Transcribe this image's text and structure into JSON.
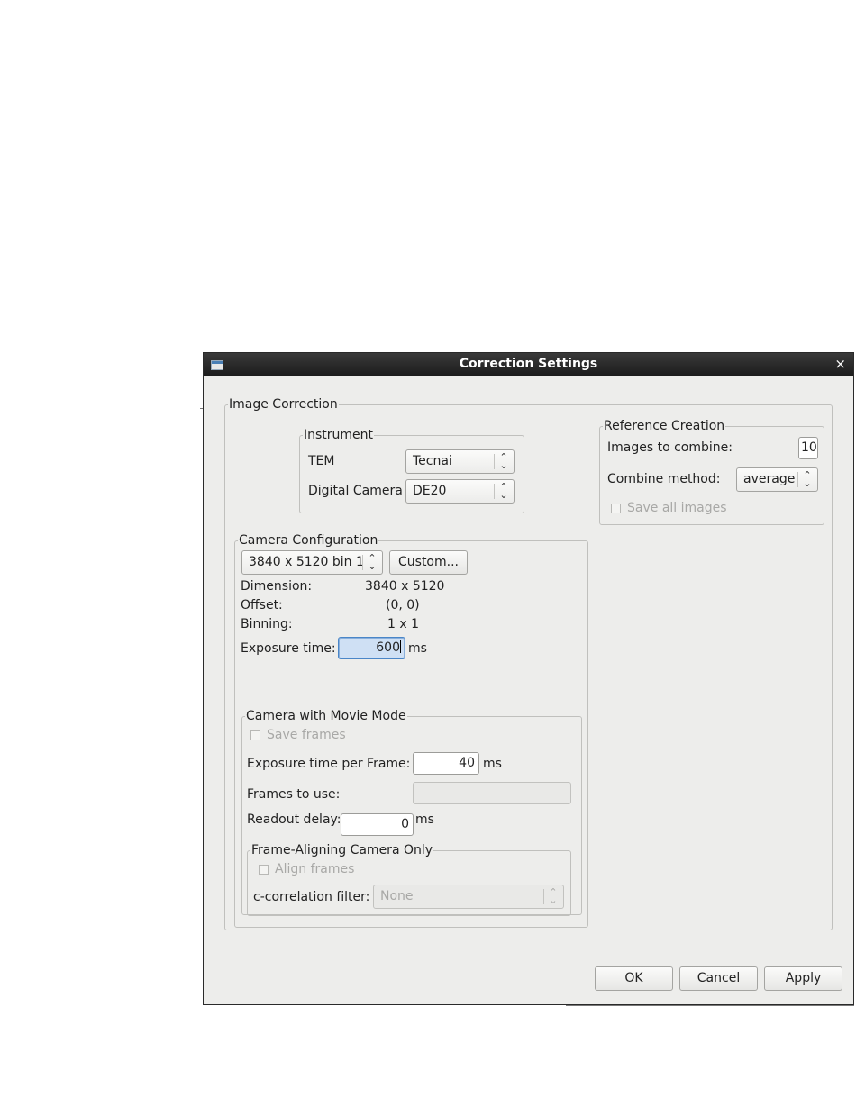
{
  "dialog": {
    "title": "Correction Settings",
    "close_glyph": "×"
  },
  "image_correction": {
    "legend": "Image Correction",
    "instrument": {
      "legend": "Instrument",
      "tem_label": "TEM",
      "tem_value": "Tecnai",
      "camera_label": "Digital Camera",
      "camera_value": "DE20"
    },
    "reference_creation": {
      "legend": "Reference Creation",
      "images_label": "Images to combine:",
      "images_value": "10",
      "method_label": "Combine method:",
      "method_value": "average",
      "save_all_label": "Save all images",
      "save_all_checked": false
    },
    "camera_configuration": {
      "legend": "Camera Configuration",
      "preset_value": "3840 x 5120 bin 1",
      "custom_button": "Custom...",
      "dimension_label": "Dimension:",
      "dimension_value": "3840 x 5120",
      "offset_label": "Offset:",
      "offset_value": "(0, 0)",
      "binning_label": "Binning:",
      "binning_value": "1 x 1",
      "exposure_label": "Exposure time:",
      "exposure_value": "600",
      "exposure_unit": "ms",
      "movie_mode": {
        "legend": "Camera with Movie Mode",
        "save_frames_label": "Save frames",
        "save_frames_checked": false,
        "frame_exposure_label": "Exposure time per Frame:",
        "frame_exposure_value": "40",
        "frame_exposure_unit": "ms",
        "frames_to_use_label": "Frames to use:",
        "frames_to_use_value": "",
        "readout_label": "Readout delay:",
        "readout_value": "0",
        "readout_unit": "ms",
        "frame_aligning": {
          "legend": "Frame-Aligning Camera Only",
          "align_label": "Align frames",
          "align_checked": false,
          "filter_label": "c-correlation filter:",
          "filter_value": "None"
        }
      }
    }
  },
  "buttons": {
    "ok": "OK",
    "cancel": "Cancel",
    "apply": "Apply"
  },
  "icons": {
    "window": "window-icon",
    "close": "close-icon",
    "combo_arrow": "updown-chevron-icon",
    "combo_arrow_glyph": "⌃⌄"
  }
}
